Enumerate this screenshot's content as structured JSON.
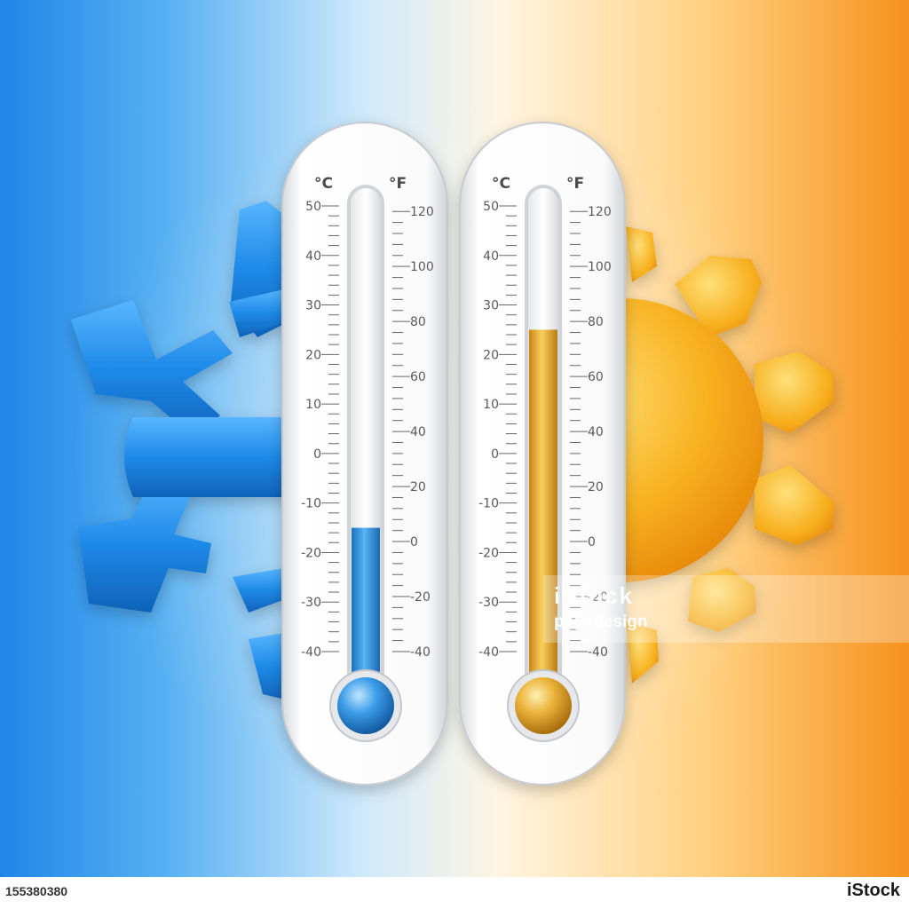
{
  "scene": {
    "left_thermometer": {
      "celsius_label": "°C",
      "fahrenheit_label": "°F",
      "celsius_ticks": [
        "50",
        "40",
        "30",
        "20",
        "10",
        "0",
        "-10",
        "-20",
        "-30",
        "-40"
      ],
      "fahrenheit_ticks": [
        "120",
        "100",
        "80",
        "60",
        "40",
        "20",
        "0",
        "-20",
        "-40"
      ],
      "reading_celsius": -15,
      "liquid_color": "#2f8fd8"
    },
    "right_thermometer": {
      "celsius_label": "°C",
      "fahrenheit_label": "°F",
      "celsius_ticks": [
        "50",
        "40",
        "30",
        "20",
        "10",
        "0",
        "-10",
        "-20",
        "-30",
        "-40"
      ],
      "fahrenheit_ticks": [
        "120",
        "100",
        "80",
        "60",
        "40",
        "20",
        "0",
        "-20",
        "-40"
      ],
      "reading_celsius": 25,
      "liquid_color": "#e3a62c"
    },
    "snowflake_color": "#1e90e8",
    "sun_color": "#f7b21c"
  },
  "watermark": {
    "logo": "iStock",
    "credit": "pagadesign"
  },
  "footer": {
    "image_id": "155380380",
    "brand": "iStock"
  }
}
